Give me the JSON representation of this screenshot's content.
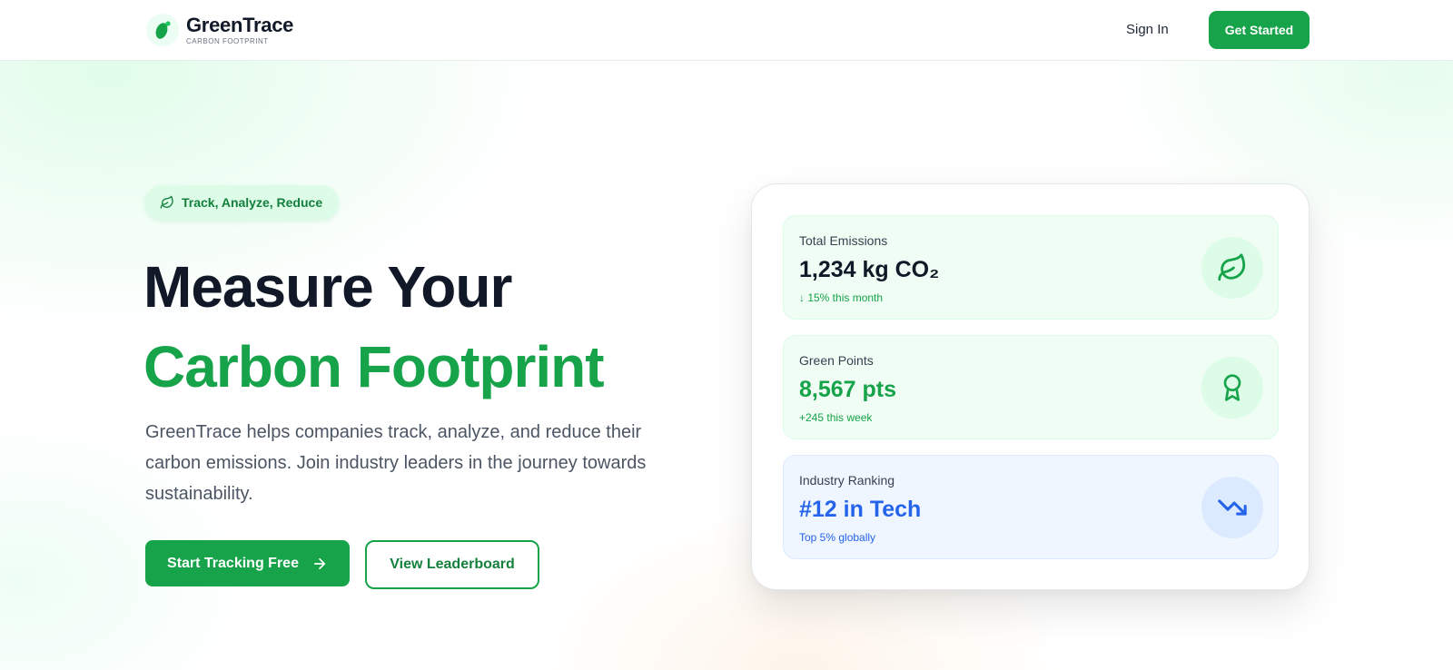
{
  "brand": {
    "name": "GreenTrace",
    "tagline": "CARBON FOOTPRINT"
  },
  "nav": {
    "sign_in": "Sign In",
    "get_started": "Get Started"
  },
  "hero": {
    "badge": "Track, Analyze, Reduce",
    "title_line1": "Measure Your",
    "title_line2": "Carbon Footprint",
    "description": "GreenTrace helps companies track, analyze, and reduce their carbon emissions. Join industry leaders in the journey towards sustainability.",
    "primary_cta": "Start Tracking Free",
    "secondary_cta": "View Leaderboard"
  },
  "stats": [
    {
      "label": "Total Emissions",
      "value": "1,234 kg CO₂",
      "note": "↓ 15% this month",
      "icon": "leaf-icon"
    },
    {
      "label": "Green Points",
      "value": "8,567 pts",
      "note": "+245 this week",
      "icon": "award-icon"
    },
    {
      "label": "Industry Ranking",
      "value": "#12 in Tech",
      "note": "Top 5% globally",
      "icon": "trending-down-icon"
    }
  ],
  "colors": {
    "brand_green": "#16a34a",
    "dark_text": "#111827",
    "blue_accent": "#2563eb"
  }
}
